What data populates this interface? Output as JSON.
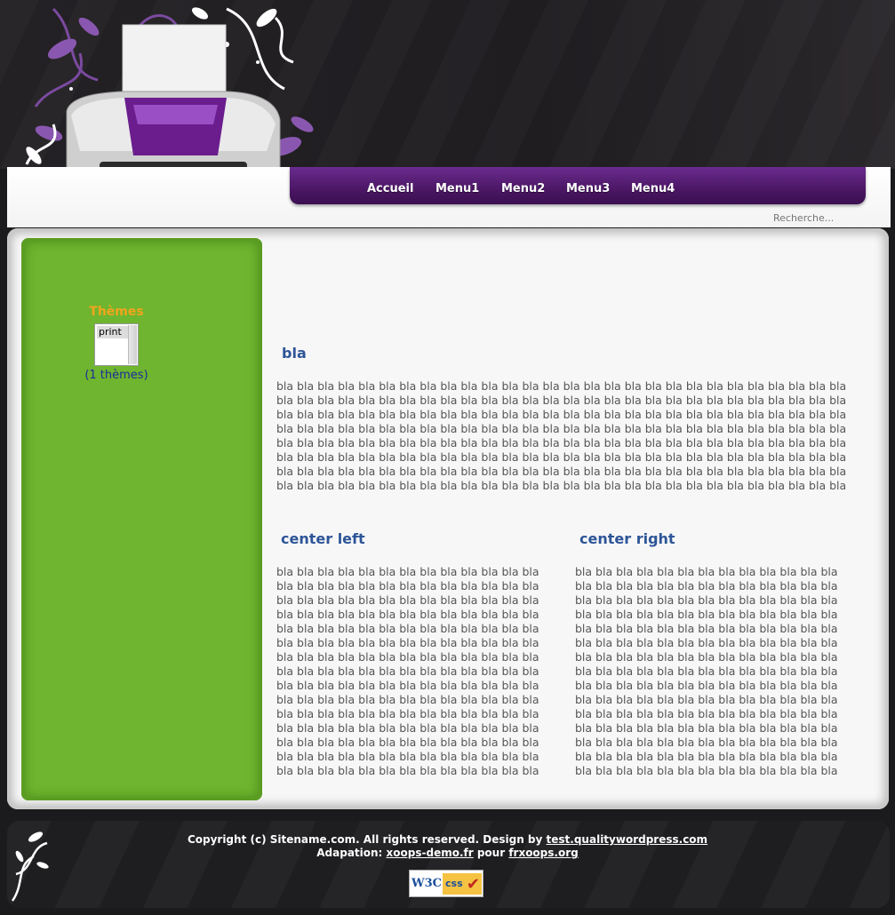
{
  "nav": {
    "items": [
      "Accueil",
      "Menu1",
      "Menu2",
      "Menu3",
      "Menu4"
    ]
  },
  "search": {
    "placeholder": "Recherche..."
  },
  "sidebar": {
    "themes_title": "Thèmes",
    "themes_selected": "print",
    "themes_count": "(1 thèmes)"
  },
  "main": {
    "center_title": "bla",
    "center_text": "bla bla bla bla bla bla bla bla bla bla bla bla bla bla bla bla bla bla bla bla bla bla bla bla bla bla bla bla bla bla bla bla bla bla bla bla bla bla bla bla bla bla bla bla bla bla bla bla bla bla bla bla bla bla bla bla bla bla bla bla bla bla bla bla bla bla bla bla bla bla bla bla bla bla bla bla bla bla bla bla bla bla bla bla bla bla bla bla bla bla bla bla bla bla bla bla bla bla bla bla bla bla bla bla bla bla bla bla bla bla bla bla bla bla bla bla bla bla bla bla bla bla bla bla bla bla bla bla bla bla bla bla bla bla bla bla bla bla bla bla bla bla bla bla bla bla bla bla bla bla bla bla bla bla bla bla bla bla bla bla bla bla bla bla bla bla bla bla bla bla bla bla bla bla bla bla bla bla bla bla bla bla bla bla bla bla bla bla bla bla bla bla bla bla bla bla bla bla bla bla bla bla bla bla bla bla bla bla bla bla bla bla bla bla bla bla bla bla bla bla bla bla bla bla bla bla",
    "left_title": "center left",
    "left_text": "bla bla bla bla bla bla bla bla bla bla bla bla bla bla bla bla bla bla bla bla bla bla bla bla bla bla bla bla bla bla bla bla bla bla bla bla bla bla bla bla bla bla bla bla bla bla bla bla bla bla bla bla bla bla bla bla bla bla bla bla bla bla bla bla bla bla bla bla bla bla bla bla bla bla bla bla bla bla bla bla bla bla bla bla bla bla bla bla bla bla bla bla bla bla bla bla bla bla bla bla bla bla bla bla bla bla bla bla bla bla bla bla bla bla bla bla bla bla bla bla bla bla bla bla bla bla bla bla bla bla bla bla bla bla bla bla bla bla bla bla bla bla bla bla bla bla bla bla bla bla bla bla bla bla bla bla bla bla bla bla bla bla bla bla bla bla bla bla bla bla bla bla bla bla bla bla bla bla bla bla bla bla bla bla bla bla bla bla bla bla bla bla bla bla bla bla bla bla bla bla bla bla bla bla bla bla bla bla",
    "right_title": "center right",
    "right_text": "bla bla bla bla bla bla bla bla bla bla bla bla bla bla bla bla bla bla bla bla bla bla bla bla bla bla bla bla bla bla bla bla bla bla bla bla bla bla bla bla bla bla bla bla bla bla bla bla bla bla bla bla bla bla bla bla bla bla bla bla bla bla bla bla bla bla bla bla bla bla bla bla bla bla bla bla bla bla bla bla bla bla bla bla bla bla bla bla bla bla bla bla bla bla bla bla bla bla bla bla bla bla bla bla bla bla bla bla bla bla bla bla bla bla bla bla bla bla bla bla bla bla bla bla bla bla bla bla bla bla bla bla bla bla bla bla bla bla bla bla bla bla bla bla bla bla bla bla bla bla bla bla bla bla bla bla bla bla bla bla bla bla bla bla bla bla bla bla bla bla bla bla bla bla bla bla bla bla bla bla bla bla bla bla bla bla bla bla bla bla bla bla bla bla bla bla bla bla bla bla bla bla bla bla bla bla bla bla"
  },
  "footer": {
    "copyright_prefix": "Copyright (c) Sitename.com. All rights reserved. Design by ",
    "design_link": "test.qualitywordpress.com",
    "adaptation_prefix": "Adapation: ",
    "adaptation_link": "xoops-demo.fr",
    "adaptation_mid": " pour ",
    "frxoops_link": "frxoops.org",
    "badge_w3c": "W3C",
    "badge_css": "css"
  },
  "colors": {
    "accent_purple": "#5a1f7a",
    "sidebar_green": "#6fb52f",
    "title_blue": "#2d5597",
    "themes_orange": "#f1a51d"
  }
}
